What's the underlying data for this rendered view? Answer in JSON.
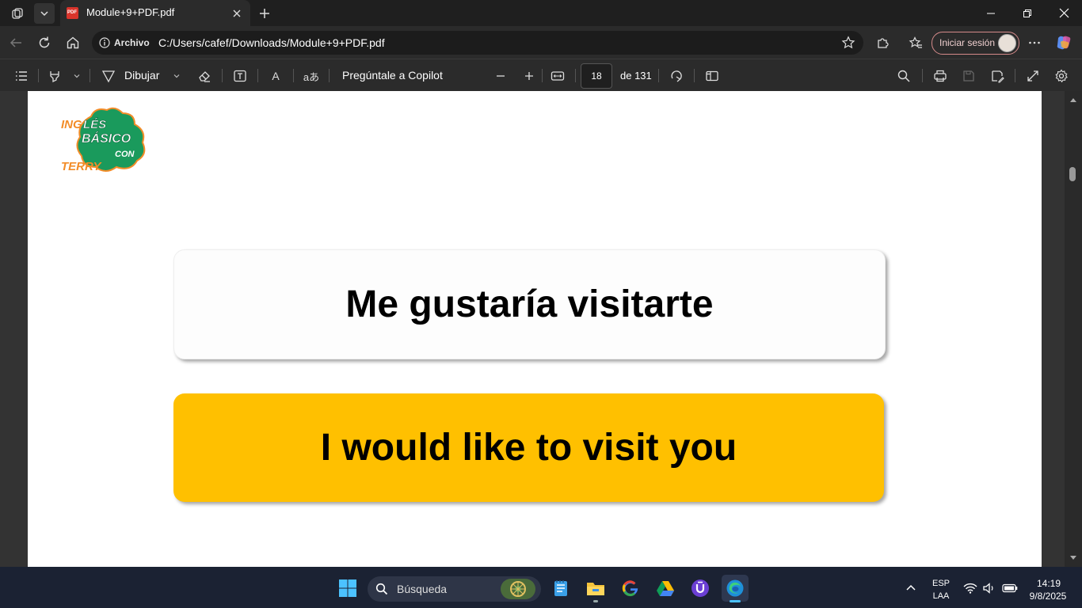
{
  "window": {
    "tab_title": "Module+9+PDF.pdf",
    "tab_icon_label": "PDF"
  },
  "address_bar": {
    "site_label": "Archivo",
    "url": "C:/Users/cafef/Downloads/Module+9+PDF.pdf",
    "signin_label": "Iniciar sesión"
  },
  "pdf_toolbar": {
    "draw_label": "Dibujar",
    "copilot_label": "Pregúntale a Copilot",
    "read_aloud_label": "A",
    "translate_label": "aあ",
    "page_current": "18",
    "page_total_label": "de 131"
  },
  "document": {
    "logo": {
      "line1": "INGLÉS",
      "line2": "BÁSICO",
      "line3": "CON",
      "line4": "TERRY"
    },
    "spanish_phrase": "Me gustaría visitarte",
    "english_phrase": "I would like to visit you",
    "scroll_position": 0.14
  },
  "taskbar": {
    "search_placeholder": "Búsqueda",
    "language": "ESP",
    "keyboard_layout": "LAA",
    "time": "14:19",
    "date": "9/8/2025"
  },
  "colors": {
    "card_highlight": "#ffc000",
    "logo_green": "#1a9a5c",
    "logo_orange": "#f28c28",
    "accent": "#0078d4"
  }
}
